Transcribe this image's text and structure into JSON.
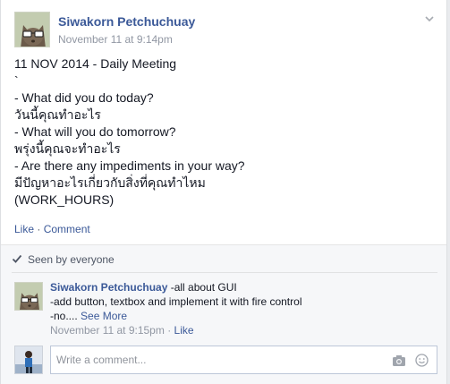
{
  "post": {
    "author": "Siwakorn Petchuchuay",
    "timestamp": "November 11 at 9:14pm",
    "lines": [
      "11 NOV 2014 - Daily Meeting",
      "`",
      "- What did you do today?",
      "วันนี้คุณทำอะไร",
      "- What will you do tomorrow?",
      "พรุ่งนี้คุณจะทำอะไร",
      "- Are there any impediments in your way?",
      "มีปัญหาอะไรเกี่ยวกับสิ่งที่คุณทำไหม",
      "(WORK_HOURS)"
    ],
    "actions": {
      "like": "Like",
      "separator": " · ",
      "comment": "Comment"
    }
  },
  "feedback": {
    "seen_text": "Seen by everyone",
    "comment": {
      "author": "Siwakorn Petchuchuay",
      "text_line1": " -all about GUI",
      "text_line2": "-add button, textbox and implement it with fire control",
      "text_line3": "-no.... ",
      "see_more": "See More",
      "timestamp": "November 11 at 9:15pm",
      "meta_separator": " · ",
      "like": "Like"
    },
    "composer": {
      "placeholder": "Write a comment..."
    }
  },
  "colors": {
    "link": "#3b5998",
    "muted": "#9197a3",
    "feedback_bg": "#f6f7f9"
  },
  "icons": [
    "chevron-down-icon",
    "checkmark-icon",
    "camera-icon",
    "emoji-icon"
  ]
}
